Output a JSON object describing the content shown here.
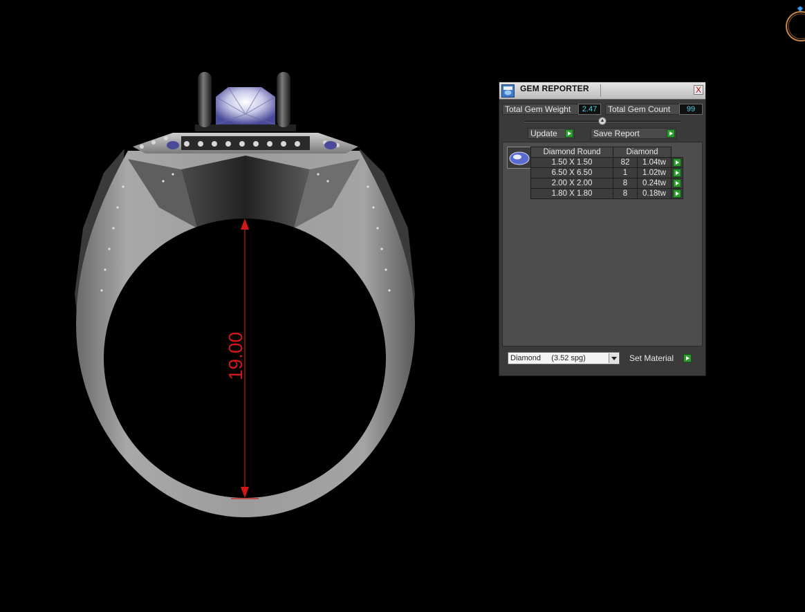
{
  "app": {
    "dimension_label": "19.00"
  },
  "gem_reporter": {
    "title": "GEM REPORTER",
    "close_glyph": "X",
    "total_gem_weight_label": "Total Gem Weight",
    "total_gem_weight_value": "2.47",
    "total_gem_count_label": "Total Gem Count",
    "total_gem_count_value": "99",
    "update_label": "Update",
    "save_report_label": "Save Report",
    "table": {
      "headers": [
        "Diamond Round",
        "Diamond"
      ],
      "rows": [
        {
          "size": "1.50 X 1.50",
          "count": "82",
          "weight": "1.04tw"
        },
        {
          "size": "6.50 X 6.50",
          "count": "1",
          "weight": "1.02tw"
        },
        {
          "size": "2.00 X 2.00",
          "count": "8",
          "weight": "0.24tw"
        },
        {
          "size": "1.80 X 1.80",
          "count": "8",
          "weight": "0.18tw"
        }
      ]
    },
    "material_select_value": "Diamond     (3.52 spg)",
    "set_material_label": "Set Material"
  },
  "colors": {
    "background": "#000000",
    "metal": "#8c8c8c",
    "dimension_red": "#d01818",
    "panel_bg": "#3a3a3a",
    "value_cyan": "#4fd0e0",
    "go_green": "#2f9a2f"
  },
  "icons": {
    "corner": "ring-logo-icon",
    "title": "gem-reporter-icon",
    "gem_thumb": "diamond-round-icon"
  }
}
